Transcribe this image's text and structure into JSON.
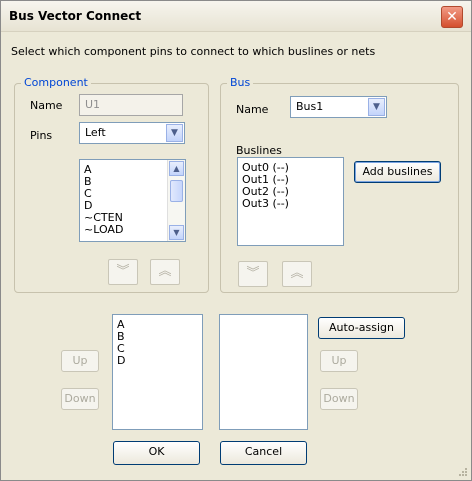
{
  "window": {
    "title": "Bus Vector Connect"
  },
  "instruction": "Select which component pins to connect to which buslines or nets",
  "component": {
    "legend": "Component",
    "name_label": "Name",
    "name_value": "U1",
    "pins_label": "Pins",
    "pins_value": "Left",
    "pins_list": [
      "A",
      "B",
      "C",
      "D",
      "~CTEN",
      "~LOAD"
    ]
  },
  "bus": {
    "legend": "Bus",
    "name_label": "Name",
    "name_value": "Bus1",
    "buslines_label": "Buslines",
    "buslines_list": [
      "Out0 (--)",
      "Out1 (--)",
      "Out2 (--)",
      "Out3 (--)"
    ],
    "add_buslines_label": "Add buslines"
  },
  "assignment": {
    "pins_list": [
      "A",
      "B",
      "C",
      "D"
    ],
    "nets_list": [],
    "auto_assign_label": "Auto-assign",
    "left_up_label": "Up",
    "left_down_label": "Down",
    "right_up_label": "Up",
    "right_down_label": "Down"
  },
  "footer": {
    "ok_label": "OK",
    "cancel_label": "Cancel"
  },
  "icons": {
    "close": "close-icon",
    "dropdown": "chevron-down-icon",
    "move_down": "double-chevron-down-icon",
    "move_up": "double-chevron-up-icon"
  }
}
